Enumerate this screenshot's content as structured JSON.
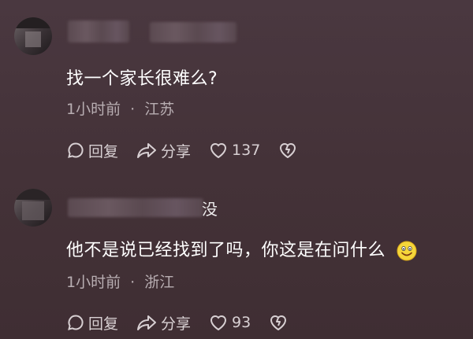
{
  "comments": [
    {
      "name_suffix": "",
      "text": "找一个家长很难么?",
      "time": "1小时前",
      "separator": "·",
      "location": "江苏",
      "reply_label": "回复",
      "share_label": "分享",
      "like_count": "137"
    },
    {
      "name_suffix": "没",
      "text": "他不是说已经找到了吗，你这是在问什么",
      "emoji_icon": "smiling-face-emoji-icon",
      "time": "1小时前",
      "separator": "·",
      "location": "浙江",
      "reply_label": "回复",
      "share_label": "分享",
      "like_count": "93"
    }
  ],
  "colors": {
    "background": "#443238",
    "text": "#ffffff",
    "meta": "#b8aeb2",
    "action": "#d8d0d3"
  }
}
